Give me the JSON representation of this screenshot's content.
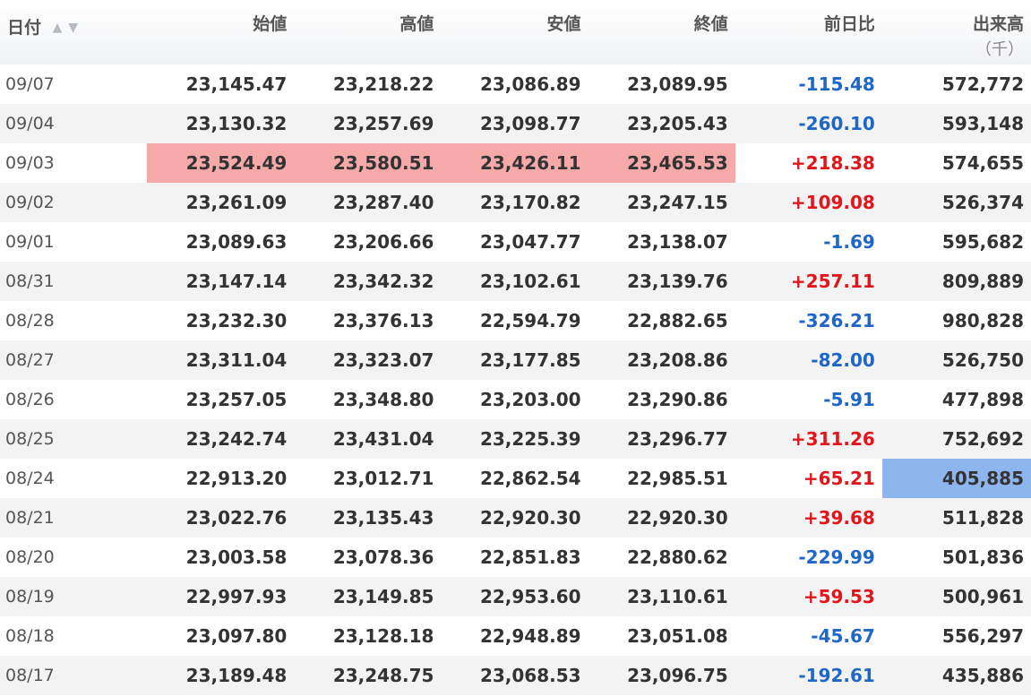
{
  "columns": {
    "date": "日付",
    "open": "始値",
    "high": "高値",
    "low": "安値",
    "close": "終値",
    "change": "前日比",
    "volume": "出来高",
    "volume_unit": "（千）"
  },
  "sort_icons": {
    "up": "▲",
    "down": "▼"
  },
  "colors": {
    "negative": "#1e66c8",
    "positive": "#e3151a",
    "highlight_red": "#f5a9a9",
    "highlight_blue": "#8db6ee"
  },
  "rows": [
    {
      "date": "09/07",
      "open": "23,145.47",
      "high": "23,218.22",
      "low": "23,086.89",
      "close": "23,089.95",
      "change": "-115.48",
      "volume": "572,772"
    },
    {
      "date": "09/04",
      "open": "23,130.32",
      "high": "23,257.69",
      "low": "23,098.77",
      "close": "23,205.43",
      "change": "-260.10",
      "volume": "593,148"
    },
    {
      "date": "09/03",
      "open": "23,524.49",
      "high": "23,580.51",
      "low": "23,426.11",
      "close": "23,465.53",
      "change": "+218.38",
      "volume": "574,655"
    },
    {
      "date": "09/02",
      "open": "23,261.09",
      "high": "23,287.40",
      "low": "23,170.82",
      "close": "23,247.15",
      "change": "+109.08",
      "volume": "526,374"
    },
    {
      "date": "09/01",
      "open": "23,089.63",
      "high": "23,206.66",
      "low": "23,047.77",
      "close": "23,138.07",
      "change": "-1.69",
      "volume": "595,682"
    },
    {
      "date": "08/31",
      "open": "23,147.14",
      "high": "23,342.32",
      "low": "23,102.61",
      "close": "23,139.76",
      "change": "+257.11",
      "volume": "809,889"
    },
    {
      "date": "08/28",
      "open": "23,232.30",
      "high": "23,376.13",
      "low": "22,594.79",
      "close": "22,882.65",
      "change": "-326.21",
      "volume": "980,828"
    },
    {
      "date": "08/27",
      "open": "23,311.04",
      "high": "23,323.07",
      "low": "23,177.85",
      "close": "23,208.86",
      "change": "-82.00",
      "volume": "526,750"
    },
    {
      "date": "08/26",
      "open": "23,257.05",
      "high": "23,348.80",
      "low": "23,203.00",
      "close": "23,290.86",
      "change": "-5.91",
      "volume": "477,898"
    },
    {
      "date": "08/25",
      "open": "23,242.74",
      "high": "23,431.04",
      "low": "23,225.39",
      "close": "23,296.77",
      "change": "+311.26",
      "volume": "752,692"
    },
    {
      "date": "08/24",
      "open": "22,913.20",
      "high": "23,012.71",
      "low": "22,862.54",
      "close": "22,985.51",
      "change": "+65.21",
      "volume": "405,885"
    },
    {
      "date": "08/21",
      "open": "23,022.76",
      "high": "23,135.43",
      "low": "22,920.30",
      "close": "22,920.30",
      "change": "+39.68",
      "volume": "511,828"
    },
    {
      "date": "08/20",
      "open": "23,003.58",
      "high": "23,078.36",
      "low": "22,851.83",
      "close": "22,880.62",
      "change": "-229.99",
      "volume": "501,836"
    },
    {
      "date": "08/19",
      "open": "22,997.93",
      "high": "23,149.85",
      "low": "22,953.60",
      "close": "23,110.61",
      "change": "+59.53",
      "volume": "500,961"
    },
    {
      "date": "08/18",
      "open": "23,097.80",
      "high": "23,128.18",
      "low": "22,948.89",
      "close": "23,051.08",
      "change": "-45.67",
      "volume": "556,297"
    },
    {
      "date": "08/17",
      "open": "23,189.48",
      "high": "23,248.75",
      "low": "23,068.53",
      "close": "23,096.75",
      "change": "-192.61",
      "volume": "435,886"
    }
  ]
}
